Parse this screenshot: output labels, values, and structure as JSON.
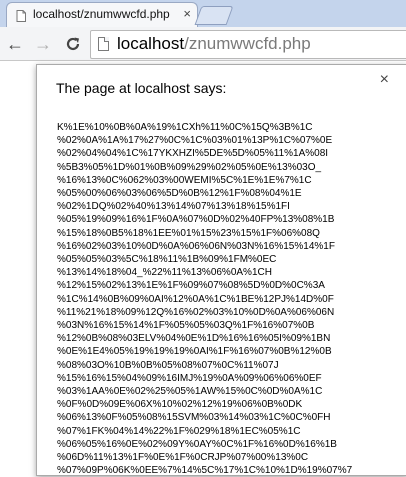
{
  "tab": {
    "title": "localhost/znumwwcfd.php",
    "close_glyph": "×"
  },
  "toolbar": {
    "back_glyph": "←",
    "forward_glyph": "→",
    "reload_glyph": "C",
    "url_host": "localhost",
    "url_path": "/znumwwcfd.php"
  },
  "dialog": {
    "title": "The page at localhost says:",
    "close_glyph": "×",
    "message_lines": [
      "K%1E%10%0B%0A%19%1CXh%11%0C%15Q%3B%1C",
      "%02%0A%1A%17%27%0C%1C%03%01%13P%1C%07%0E",
      "%02%04%04%1C%17YKXHZI%5DE%5D%05%11%1A%08I",
      "%5B3%05%1D%01%0B%09%29%02%05%0E%13%03O_",
      "%16%13%0C%062%03%00WEMI%5C%1E%1E%7%1C",
      "%05%00%06%03%06%5D%0B%12%1F%08%04%1E",
      "%02%1DQ%02%40%13%14%07%13%18%15%1FI",
      "%05%19%09%16%1F%0A%07%0D%02%40FP%13%08%1B",
      "%15%18%0B5%18%1EE%01%15%23%15%1F%06%08Q",
      "%16%02%03%10%0D%0A%06%06N%03N%16%15%14%1F",
      "%05%05%03%5C%18%11%1B%09%1FM%0EC",
      "%13%14%18%04_%22%11%13%06%0A%1CH",
      "%12%15%02%13%1E%1F%09%07%08%5D%0D%0C%3A",
      "%1C%14%0B%09%0AI%12%0A%1C%1BE%12PJ%14D%0F",
      "%11%21%18%09%12Q%16%02%03%10%0D%0A%06%06N",
      "%03N%16%15%14%1F%05%05%03Q%1F%16%07%0B",
      "%12%0B%08%03ELV%04%0E%1D%16%16%05I%09%1BN",
      "%0E%1E4%05%19%19%19%0AI%1F%16%07%0B%12%0B",
      "%08%03O%10B%0B%05%08%07%0C%11%07J",
      "%15%16%15%04%09%16IMJ%19%0A%09%06%06%0EF",
      "%03%1AA%0E%02%25%05%1AW%15%0C%0D%0A%1C",
      "%0F%0D%09E%06X%10%02%12%19%06%0B%0DK",
      "%06%13%0F%05%08%15SVM%03%14%03%1C%0C%0FH",
      "%07%1FK%04%14%22%1F%029%18%1EC%05%1C",
      "%06%05%16%0E%02%09Y%0AY%0C%1F%16%0D%16%1B",
      "%06D%11%13%1F%0E%1F%0CRJP%07%00%13%0C",
      "%07%09P%06K%0EE%7%14%5C%17%1C%10%1D%19%07%7"
    ]
  }
}
